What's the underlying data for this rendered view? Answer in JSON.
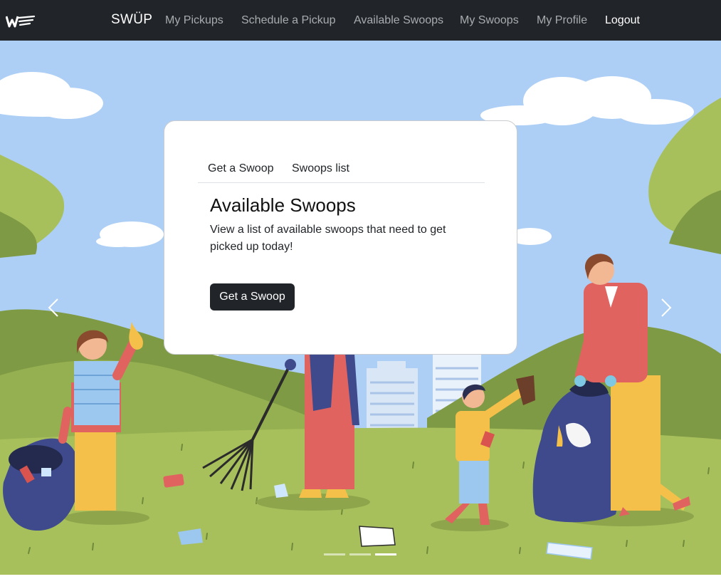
{
  "nav": {
    "brand": "SWÜP",
    "links": [
      {
        "label": "My Pickups"
      },
      {
        "label": "Schedule a Pickup"
      },
      {
        "label": "Available Swoops"
      },
      {
        "label": "My Swoops"
      },
      {
        "label": "My Profile"
      },
      {
        "label": "Logout"
      }
    ]
  },
  "card": {
    "tabs": [
      {
        "label": "Get a Swoop"
      },
      {
        "label": "Swoops list"
      }
    ],
    "title": "Available Swoops",
    "text": "View a list of available swoops that need to get picked up today!",
    "button": "Get a Swoop"
  },
  "carousel": {
    "slide_count": 3,
    "active_slide": 3,
    "prev_icon": "chevron-left-icon",
    "next_icon": "chevron-right-icon"
  },
  "colors": {
    "navbar": "#212529",
    "nav_link": "#a9acaf",
    "nav_link_active": "#ffffff",
    "sky": "#aecff5",
    "grass": "#a8c05c",
    "button": "#212529"
  },
  "icons": {
    "logo": "swup-logo-icon"
  }
}
